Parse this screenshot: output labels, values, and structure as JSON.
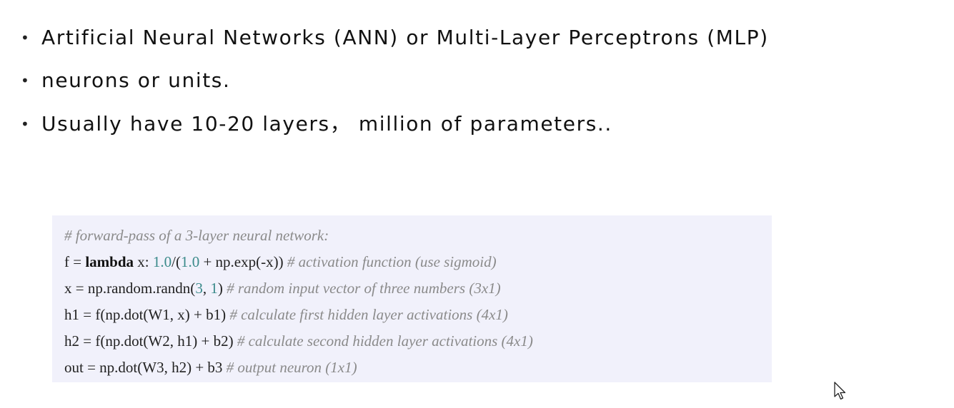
{
  "bullets": [
    {
      "text": "Artificial Neural Networks (ANN) or Multi-Layer Perceptrons (MLP)"
    },
    {
      "text": "neurons or units."
    },
    {
      "text": "Usually have 10-20 layers， million of parameters.."
    }
  ],
  "bullet_symbol": "•",
  "code": {
    "line1": {
      "comment": "# forward-pass of a 3-layer neural network:"
    },
    "line2": {
      "p1": "f = ",
      "kw": "lambda",
      "p2": " x: ",
      "n1": "1.0",
      "p3": "/(",
      "n2": "1.0",
      "p4": " + np.exp(-x)) ",
      "comment": "# activation function (use sigmoid)"
    },
    "line3": {
      "p1": "x = np.random.randn(",
      "n1": "3",
      "p2": ", ",
      "n2": "1",
      "p3": ") ",
      "comment": "# random input vector of three numbers (3x1)"
    },
    "line4": {
      "p1": "h1 = f(np.dot(W1, x) + b1) ",
      "comment": "# calculate first hidden layer activations (4x1)"
    },
    "line5": {
      "p1": "h2 = f(np.dot(W2, h1) + b2) ",
      "comment": "# calculate second hidden layer activations (4x1)"
    },
    "line6": {
      "p1": "out = np.dot(W3, h2) + b3 ",
      "comment": "# output neuron (1x1)"
    }
  },
  "colors": {
    "code_background": "#f1f1fb",
    "comment": "#8a8a8a",
    "number": "#3a8a8a",
    "text": "#111111"
  },
  "icons": {
    "cursor": "mouse-pointer-icon"
  }
}
